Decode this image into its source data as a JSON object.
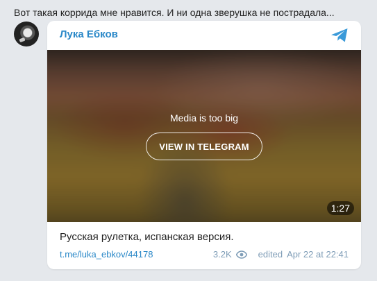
{
  "message": {
    "caption": "Вот такая коррида мне нравится. И ни одна зверушка не пострадала..."
  },
  "post": {
    "author": "Лука Ебков",
    "media": {
      "notice": "Media is too big",
      "button_label": "VIEW IN TELEGRAM",
      "duration": "1:27"
    },
    "text": "Русская рулетка, испанская версия.",
    "link": "t.me/luka_ebkov/44178",
    "views": "3.2K",
    "edited_label": "edited",
    "date": "Apr 22 at 22:41"
  },
  "icons": {
    "telegram_logo": "telegram-plane",
    "views": "eye",
    "avatar": "channel-avatar"
  },
  "colors": {
    "accent": "#2a88c8",
    "meta": "#7f9db7",
    "background": "#e5e8ec"
  }
}
